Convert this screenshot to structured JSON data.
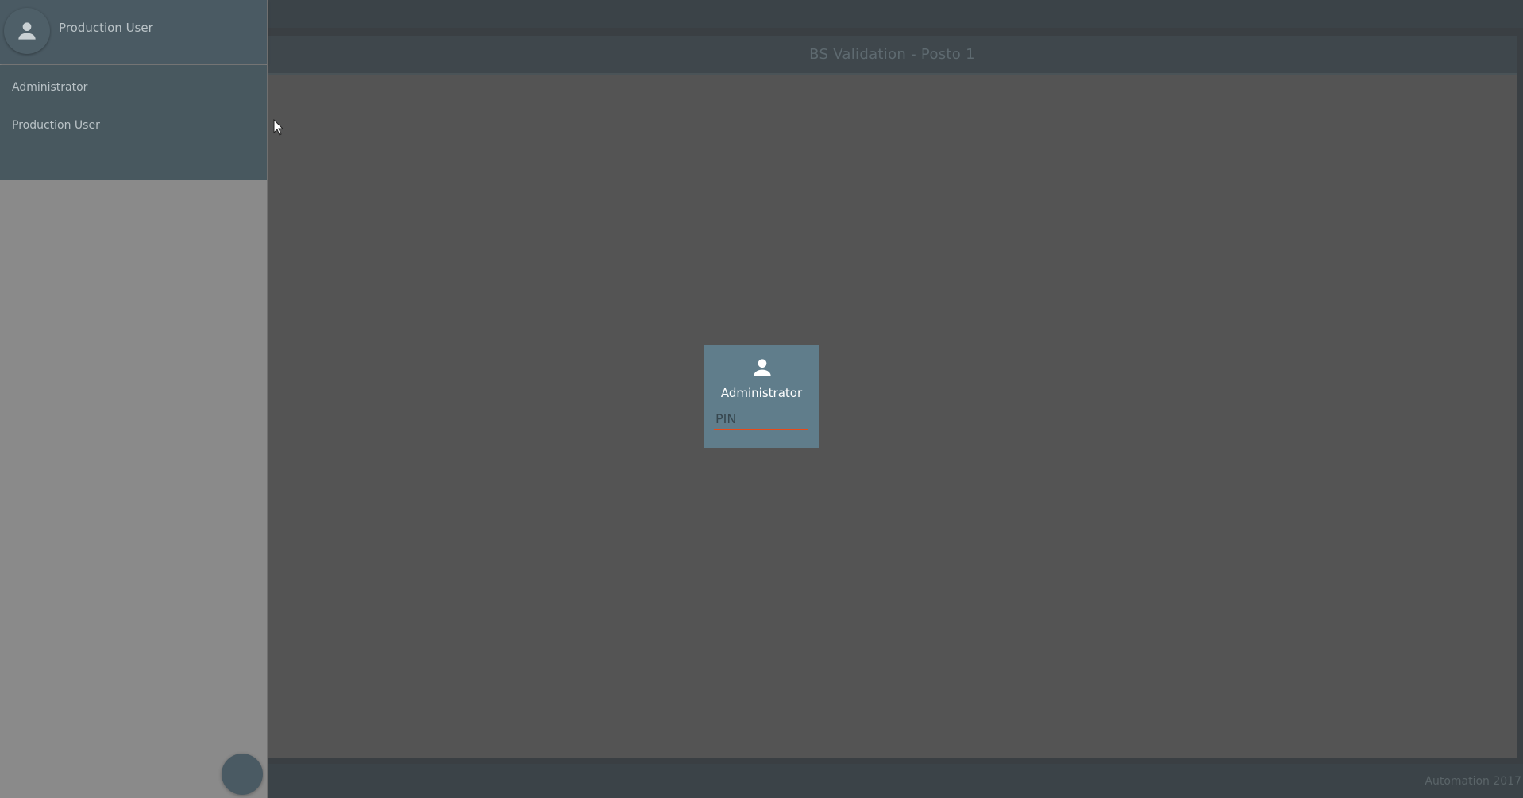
{
  "app": {
    "title": "BS Validation - Posto 1",
    "footer": "Automation 2017"
  },
  "drawer": {
    "current_user": "Production User",
    "avatar_icon": "person-icon",
    "items": [
      {
        "label": "Administrator"
      },
      {
        "label": "Production User"
      }
    ]
  },
  "login": {
    "user_name": "Administrator",
    "user_icon": "person-icon",
    "pin_placeholder": "PIN",
    "pin_value": ""
  },
  "colors": {
    "card": "#607d8b",
    "underline_accent": "#e64a19",
    "drawer_header": "#4a5a63"
  }
}
